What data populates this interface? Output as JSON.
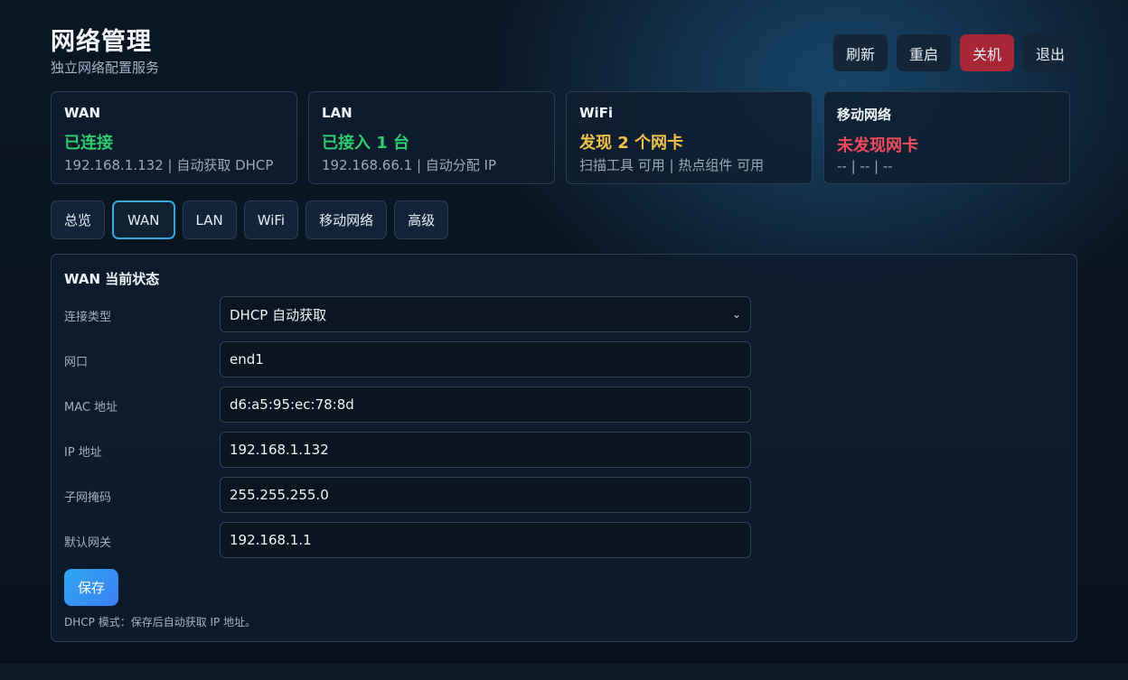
{
  "header": {
    "title": "网络管理",
    "subtitle": "独立网络配置服务",
    "buttons": [
      "刷新",
      "重启",
      "关机",
      "退出"
    ]
  },
  "colors": {
    "green": "#2ecc71",
    "yellow": "#f1c24a",
    "red": "#f24b5e",
    "accent": "#35a9d8",
    "danger": "#a82736"
  },
  "cards": [
    {
      "title": "WAN",
      "status": "已连接",
      "detail": "192.168.1.132 | 自动获取 DHCP"
    },
    {
      "title": "LAN",
      "status": "已接入 1 台",
      "detail": "192.168.66.1 | 自动分配 IP"
    },
    {
      "title": "WiFi",
      "status": "发现 2 个网卡",
      "detail": "扫描工具 可用 | 热点组件 可用"
    },
    {
      "title": "移动网络",
      "status": "未发现网卡",
      "detail": "-- | -- | --"
    }
  ],
  "tabs": [
    "总览",
    "WAN",
    "LAN",
    "WiFi",
    "移动网络",
    "高级"
  ],
  "active_tab": "WAN",
  "panel": {
    "title": "WAN 当前状态",
    "fields": [
      {
        "label": "连接类型",
        "value": "DHCP 自动获取"
      },
      {
        "label": "网口",
        "value": "end1"
      },
      {
        "label": "MAC 地址",
        "value": "d6:a5:95:ec:78:8d"
      },
      {
        "label": "IP 地址",
        "value": "192.168.1.132"
      },
      {
        "label": "子网掩码",
        "value": "255.255.255.0"
      },
      {
        "label": "默认网关",
        "value": "192.168.1.1"
      }
    ],
    "save_label": "保存",
    "note": "DHCP 模式：保存后自动获取 IP 地址。"
  }
}
